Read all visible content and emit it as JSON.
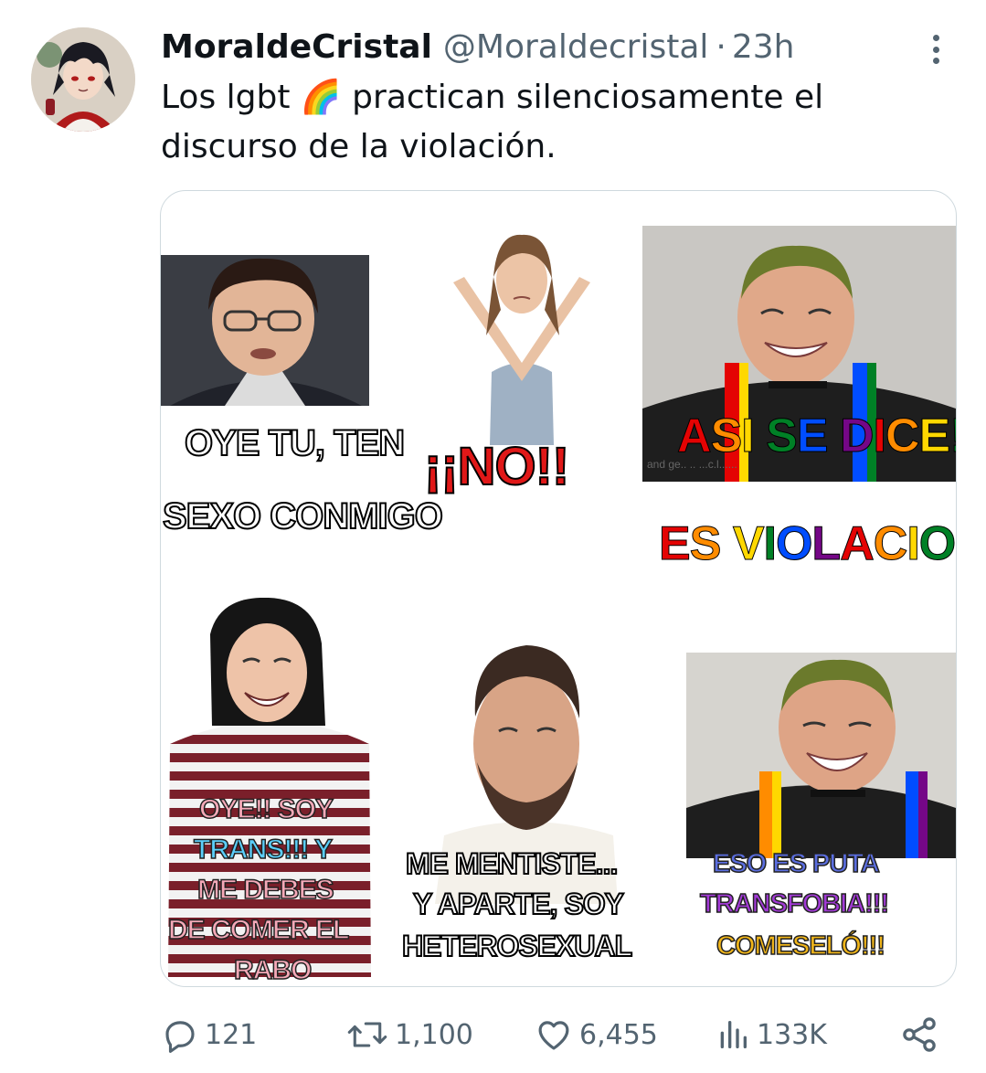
{
  "tweet": {
    "display_name": "MoraldeCristal",
    "handle": "@Moraldecristal",
    "separator": "·",
    "time": "23h",
    "text": "Los lgbt 🌈 practican silenciosamente el discurso de la violación."
  },
  "meme": {
    "panel1_line1": "OYE TU, TEN",
    "panel1_line2": "SEXO CONMIGO",
    "panel2": "¡¡NO!!",
    "panel3_watermark": "and ge.. .. ...c.l......",
    "panel3_rainbow1": "ASI SE DICE!!!",
    "panel3_rainbow2": "ES VIOLACION!!",
    "panel4_line1": "OYE!! SOY",
    "panel4_line2": "TRANS!!! Y",
    "panel4_line3": "ME DEBES",
    "panel4_line4": "DE COMER EL",
    "panel4_line5": "RABO",
    "panel5_line1": "ME MENTISTE...",
    "panel5_line2": "Y APARTE, SOY",
    "panel5_line3": "HETEROSEXUAL",
    "panel6_line1": "ESO ES PUTA",
    "panel6_line2": "TRANSFOBIA!!!",
    "panel6_line3": "COMESELÓ!!!"
  },
  "actions": {
    "replies": "121",
    "reposts": "1,100",
    "likes": "6,455",
    "views": "133K"
  },
  "colors": {
    "text_primary": "#0f1419",
    "text_secondary": "#536471",
    "border": "#cfd9de",
    "rainbow": [
      "#e40303",
      "#ff8c00",
      "#ffd800",
      "#008026",
      "#004dff",
      "#750787"
    ],
    "trans_pink": "#f5a9b8",
    "trans_blue": "#5bcefa"
  },
  "icons": [
    "reply-icon",
    "repost-icon",
    "like-icon",
    "views-icon",
    "share-icon",
    "more-icon"
  ]
}
